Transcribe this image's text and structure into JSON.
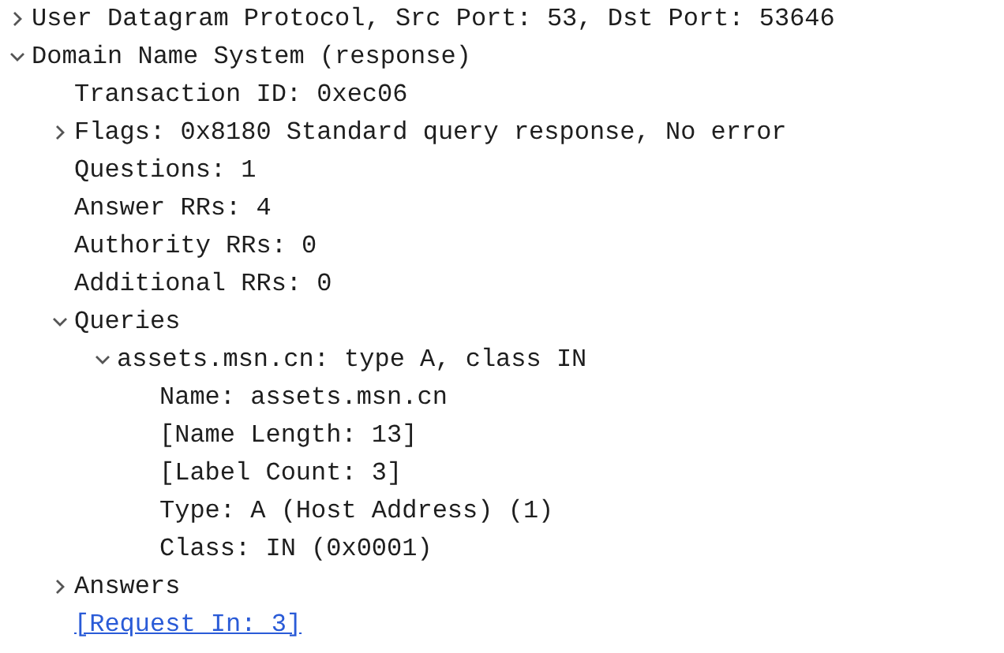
{
  "tree": [
    {
      "label": "User Datagram Protocol, Src Port: 53, Dst Port: 53646",
      "expanded": false
    },
    {
      "label": "Domain Name System (response)",
      "expanded": true,
      "children": [
        {
          "label": "Transaction ID: 0xec06"
        },
        {
          "label": "Flags: 0x8180 Standard query response, No error",
          "expanded": false
        },
        {
          "label": "Questions: 1"
        },
        {
          "label": "Answer RRs: 4"
        },
        {
          "label": "Authority RRs: 0"
        },
        {
          "label": "Additional RRs: 0"
        },
        {
          "label": "Queries",
          "expanded": true,
          "children": [
            {
              "label": "assets.msn.cn: type A, class IN",
              "expanded": true,
              "children": [
                {
                  "label": "Name: assets.msn.cn"
                },
                {
                  "label": "[Name Length: 13]"
                },
                {
                  "label": "[Label Count: 3]"
                },
                {
                  "label": "Type: A (Host Address) (1)"
                },
                {
                  "label": "Class: IN (0x0001)"
                }
              ]
            }
          ]
        },
        {
          "label": "Answers",
          "expanded": false
        },
        {
          "label": "[Request In: 3]",
          "kind": "link"
        }
      ]
    }
  ]
}
